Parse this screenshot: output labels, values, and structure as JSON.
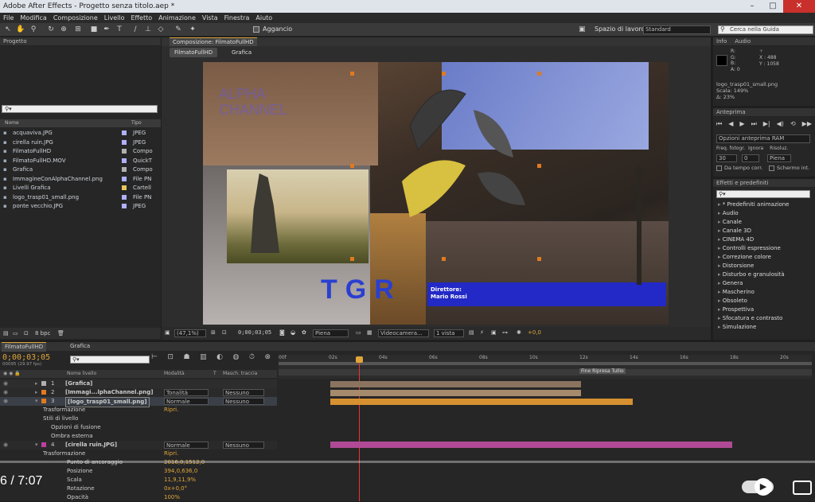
{
  "window": {
    "title": "Adobe After Effects - Progetto senza titolo.aep *"
  },
  "menu": [
    "File",
    "Modifica",
    "Composizione",
    "Livello",
    "Effetto",
    "Animazione",
    "Vista",
    "Finestra",
    "Aiuto"
  ],
  "toolbar": {
    "align_label": "Aggancio",
    "workspace_label": "Spazio di lavoro:",
    "workspace_value": "Standard",
    "search_placeholder": "Cerca nella Guida"
  },
  "project": {
    "tab": "Progetto",
    "search_value": "",
    "col_name": "Nome",
    "col_type": "Tipo",
    "items": [
      {
        "name": "acquaviva.JPG",
        "type": "JPEG",
        "color": "#b0b0ff"
      },
      {
        "name": "cirella ruin.JPG",
        "type": "JPEG",
        "color": "#b0b0ff"
      },
      {
        "name": "FilmatoFullHD",
        "type": "Compo",
        "color": "#b0b0b0"
      },
      {
        "name": "FilmatoFullHD.MOV",
        "type": "QuickT",
        "color": "#b0b0ff"
      },
      {
        "name": "Grafica",
        "type": "Compo",
        "color": "#b0b0b0"
      },
      {
        "name": "ImmagineConAlphaChannel.png",
        "type": "File PN",
        "color": "#b0b0ff"
      },
      {
        "name": "Livelli Grafica",
        "type": "Cartell",
        "color": "#e8c85a"
      },
      {
        "name": "logo_trasp01_small.png",
        "type": "File PN",
        "color": "#b0b0ff"
      },
      {
        "name": "ponte vecchio.JPG",
        "type": "JPEG",
        "color": "#b0b0ff"
      }
    ],
    "bpc": "8 bpc"
  },
  "composition": {
    "tab": "Composizione: FilmatoFullHD",
    "crumbs": [
      "FilmatoFullHD",
      "Grafica"
    ],
    "overlay": {
      "channel": "ALPHA CHANNEL",
      "tgr": "TGR",
      "director_label": "Direttore:",
      "director_name": "Mario Rossi"
    },
    "footer": {
      "zoom": "(47,1%)",
      "timecode": "0;00;03;05",
      "quality": "Piena",
      "camera": "Videocamera...",
      "views": "1 vista",
      "exposure": "+0,0"
    }
  },
  "info": {
    "tabs": [
      "Info",
      "Audio"
    ],
    "r": "R:",
    "g": "G:",
    "b": "B:",
    "a": "A: 0",
    "x": "X : 488",
    "y": "Y : 1058",
    "file": "logo_trasp01_small.png",
    "scale": "Scala: 149%",
    "delta": "Δ: 23%"
  },
  "preview": {
    "tab": "Anteprima",
    "options": "Opzioni anteprima RAM",
    "fps_label": "Freq. fotogr.",
    "skip_label": "Ignora",
    "res_label": "Risoluz.",
    "fps": "30",
    "skip": "0",
    "res": "Piena",
    "from_current": "Da tempo corr.",
    "fullscreen": "Schermo int."
  },
  "effects": {
    "tab": "Effetti e predefiniti",
    "search_value": "",
    "items": [
      "* Predefiniti animazione",
      "Audio",
      "Canale",
      "Canale 3D",
      "CINEMA 4D",
      "Controlli espressione",
      "Correzione colore",
      "Distorsione",
      "Disturbo e granulosità",
      "Genera",
      "Mascherino",
      "Obsoleto",
      "Prospettiva",
      "Sfocatura e contrasto",
      "Simulazione"
    ]
  },
  "timeline": {
    "tabs": [
      "FilmatoFullHD",
      "Grafica"
    ],
    "timecode": "0;00;03;05",
    "fps": "00095 (29.97 fps)",
    "cols": {
      "name": "Nome livello",
      "mode": "Modalità",
      "t": "T",
      "mask": "Masch. traccia"
    },
    "ruler": [
      "00f",
      "02s",
      "04s",
      "06s",
      "08s",
      "10s",
      "12s",
      "14s",
      "16s",
      "18s",
      "20s"
    ],
    "marker": "Fine Ripresa Tullio",
    "layers": [
      {
        "num": "1",
        "name": "[Grafica]",
        "mode": "",
        "mask": ""
      },
      {
        "num": "2",
        "name": "[Immagi...lphaChannel.png]",
        "mode": "Tonalità",
        "mask": "Nessuno"
      },
      {
        "num": "3",
        "name": "[logo_trasp01_small.png]",
        "mode": "Normale",
        "mask": "Nessuno"
      },
      {
        "num": "4",
        "name": "[cirella ruin.JPG]",
        "mode": "Normale",
        "mask": "Nessuno"
      }
    ],
    "props": {
      "transform": "Trasformazione",
      "reset": "Ripri.",
      "layer_styles": "Stili di livello",
      "blend": "Opzioni di fusione",
      "shadow": "Ombra esterna",
      "anchor": "Punto di ancoraggio",
      "anchor_v": "2016,0,1512,0",
      "position": "Posizione",
      "position_v": "394,0,636,0",
      "scale": "Scala",
      "scale_v": "11,9,11,9%",
      "rotation": "Rotazione",
      "rotation_v": "0x+0,0°",
      "opacity": "Opacità",
      "opacity_v": "100%"
    }
  },
  "player": {
    "time": "6 / 7:07"
  }
}
